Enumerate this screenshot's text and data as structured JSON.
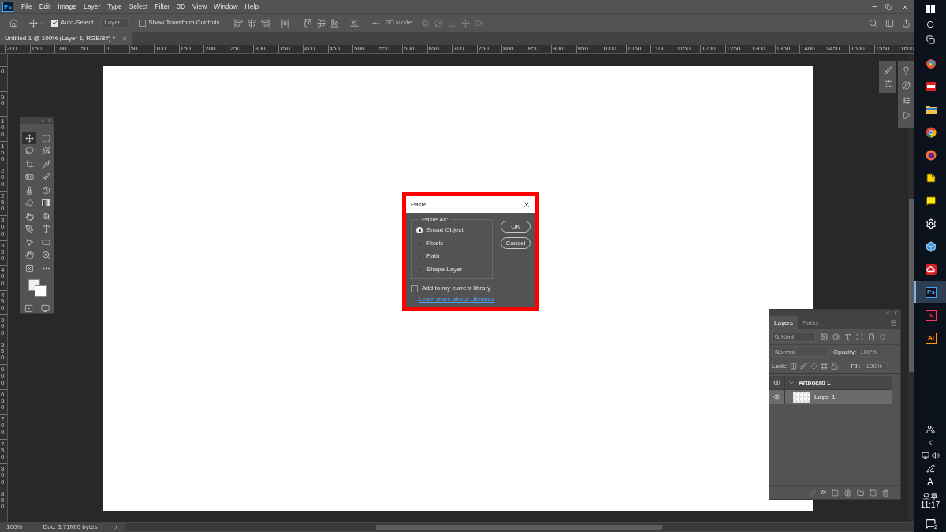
{
  "app_logo": "Ps",
  "menu_bar": {
    "items": [
      "File",
      "Edit",
      "Image",
      "Layer",
      "Type",
      "Select",
      "Filter",
      "3D",
      "View",
      "Window",
      "Help"
    ]
  },
  "options_bar": {
    "auto_select": {
      "label": "Auto-Select",
      "checked": true
    },
    "target": "Layer",
    "transform_controls": {
      "label": "Show Transform Controls",
      "checked": false
    },
    "mode_label": "3D Mode:"
  },
  "document_tab": {
    "title": "Untitled-1 @ 100% (Layer 1, RGB/8#) *"
  },
  "ruler": {
    "horizontal": [
      "200",
      "150",
      "100",
      "50",
      "0",
      "50",
      "100",
      "150",
      "200",
      "250",
      "300",
      "350",
      "400",
      "450",
      "500",
      "550",
      "600",
      "650",
      "700",
      "750",
      "800",
      "850",
      "900",
      "950",
      "1000",
      "1050",
      "1100",
      "1150",
      "1200",
      "1250",
      "1300",
      "1350",
      "1400",
      "1450",
      "1500",
      "1550",
      "1600"
    ],
    "vertical": [
      "0",
      "50",
      "100",
      "150",
      "200",
      "250",
      "300",
      "350",
      "400",
      "450",
      "500",
      "550",
      "600",
      "650",
      "700",
      "750",
      "800",
      "850"
    ]
  },
  "tools": [
    {
      "kind": "move",
      "selected": true
    },
    {
      "kind": "marquee",
      "selected": false
    },
    {
      "kind": "lasso",
      "selected": false
    },
    {
      "kind": "quick-select",
      "selected": false
    },
    {
      "kind": "crop",
      "selected": false
    },
    {
      "kind": "eyedropper",
      "selected": false
    },
    {
      "kind": "healing",
      "selected": false
    },
    {
      "kind": "brush",
      "selected": false
    },
    {
      "kind": "stamp",
      "selected": false
    },
    {
      "kind": "history",
      "selected": false
    },
    {
      "kind": "eraser",
      "selected": false
    },
    {
      "kind": "gradient",
      "selected": false
    },
    {
      "kind": "smudge",
      "selected": false
    },
    {
      "kind": "dodge",
      "selected": false
    },
    {
      "kind": "pen",
      "selected": false
    },
    {
      "kind": "type",
      "selected": false
    },
    {
      "kind": "path-select",
      "selected": false
    },
    {
      "kind": "rectangle",
      "selected": false
    },
    {
      "kind": "hand",
      "selected": false
    },
    {
      "kind": "zoom",
      "selected": false
    },
    {
      "kind": "frame",
      "selected": false
    },
    {
      "kind": "more",
      "selected": false
    }
  ],
  "paste_dialog": {
    "title": "Paste",
    "group_label": "Paste As:",
    "options": [
      {
        "label": "Smart Object",
        "selected": true
      },
      {
        "label": "Pixels",
        "selected": false
      },
      {
        "label": "Path",
        "selected": false
      },
      {
        "label": "Shape Layer",
        "selected": false
      }
    ],
    "library": {
      "label": "Add to my current library",
      "checked": false
    },
    "link": "Learn more about Libraries",
    "buttons": [
      "OK",
      "Cancel"
    ]
  },
  "layers_panel": {
    "tabs": [
      {
        "label": "Layers",
        "selected": true
      },
      {
        "label": "Paths",
        "selected": false
      }
    ],
    "filter_placeholder": "Kind",
    "blend_mode": "Normal",
    "opacity_label": "Opacity:",
    "opacity": "100%",
    "lock_label": "Lock:",
    "fill_label": "Fill:",
    "fill": "100%",
    "fx_label": "fx",
    "layers": [
      {
        "name": "Artboard 1",
        "kind": "artboard",
        "visible": true,
        "expanded": true,
        "selected": false,
        "children": [
          {
            "name": "Layer 1",
            "kind": "layer",
            "visible": true,
            "selected": true
          }
        ]
      }
    ]
  },
  "status_bar": {
    "zoom": "100%",
    "doc": "Doc: 3.71M/0 bytes"
  },
  "taskbar": {
    "apps": [
      {
        "kind": "photos",
        "selected": false
      },
      {
        "kind": "calendar",
        "selected": false
      },
      {
        "kind": "explorer",
        "selected": false
      },
      {
        "kind": "chrome",
        "selected": false
      },
      {
        "kind": "firefox",
        "selected": false
      },
      {
        "kind": "notes",
        "selected": false
      },
      {
        "kind": "talk",
        "selected": false
      },
      {
        "kind": "settings",
        "selected": false
      },
      {
        "kind": "cube",
        "selected": false
      },
      {
        "kind": "cloud",
        "selected": false
      },
      {
        "kind": "adobe",
        "label": "Ps",
        "color": "#31a8ff",
        "selected": true
      },
      {
        "kind": "adobe",
        "label": "Id",
        "color": "#ff3366",
        "selected": false
      },
      {
        "kind": "adobe",
        "label": "Ai",
        "color": "#ff9a00",
        "selected": false
      }
    ],
    "input_indicator": "A",
    "clock": "오후 11:17",
    "notifications": "2"
  }
}
